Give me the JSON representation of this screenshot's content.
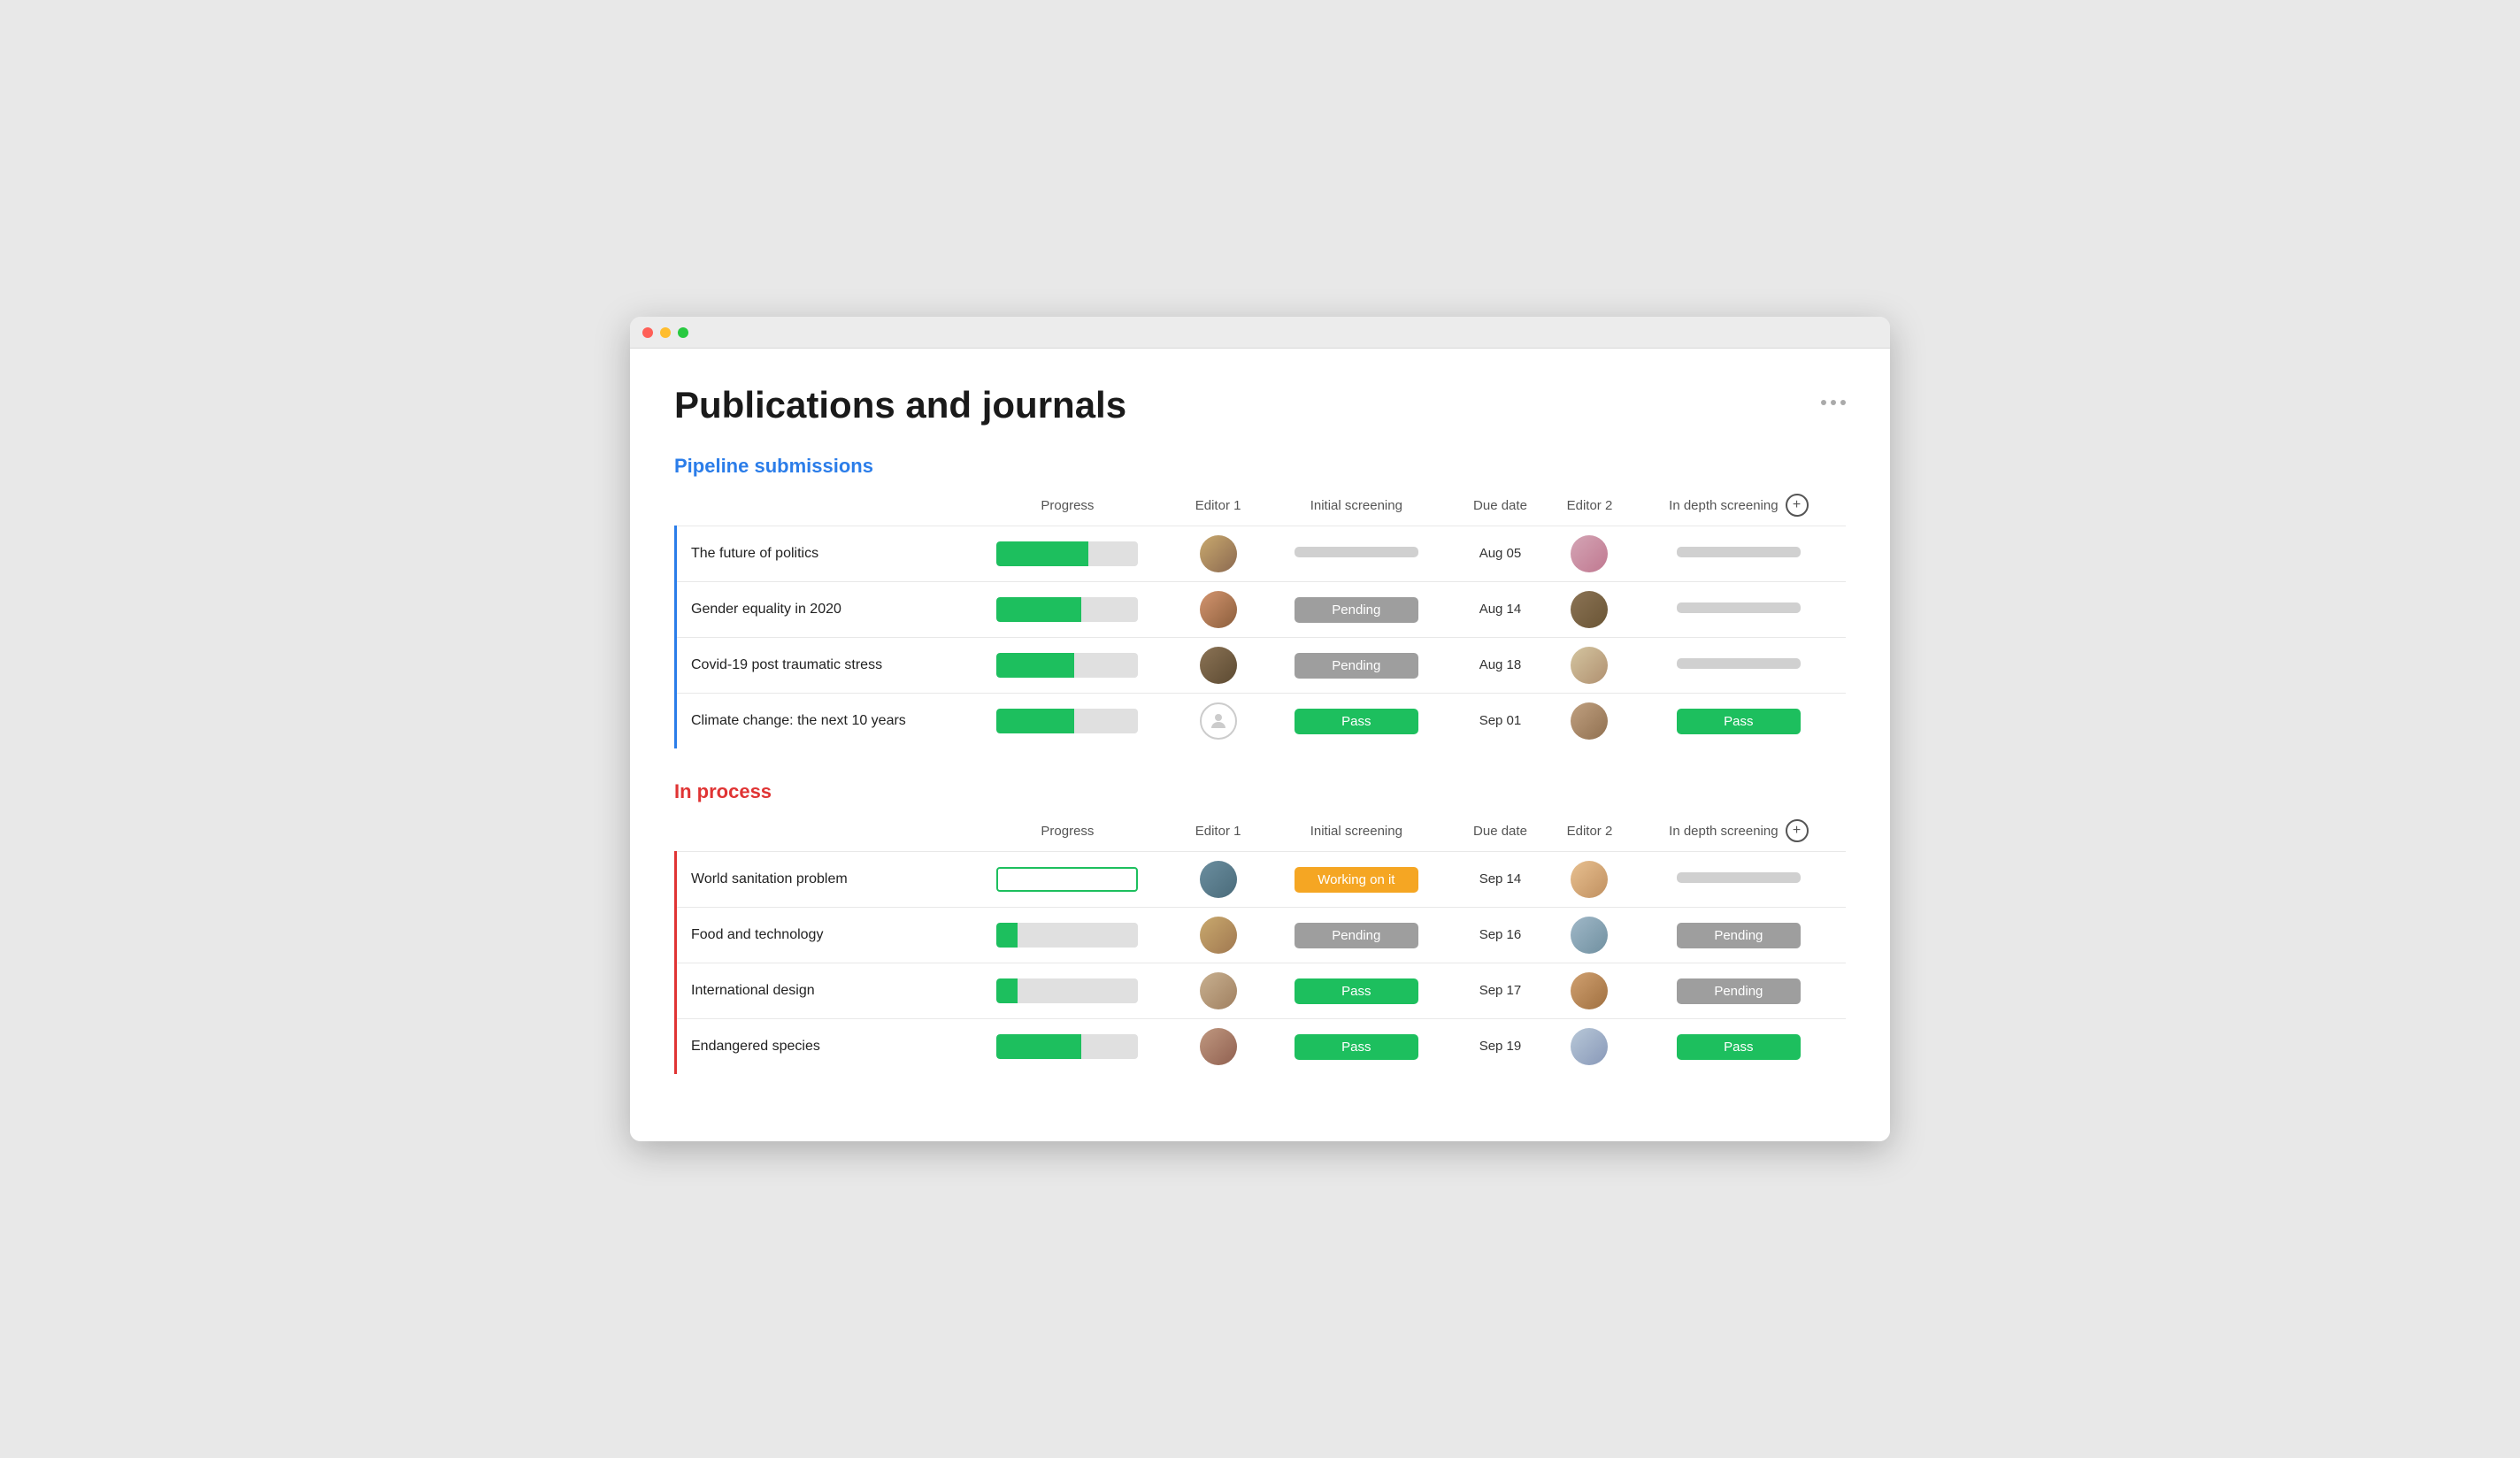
{
  "window": {
    "title": "Publications and journals"
  },
  "page": {
    "title": "Publications and journals",
    "more_label": "..."
  },
  "pipeline": {
    "section_title": "Pipeline submissions",
    "columns": {
      "title": "",
      "progress": "Progress",
      "editor1": "Editor 1",
      "initial_screening": "Initial screening",
      "due_date": "Due date",
      "editor2": "Editor 2",
      "in_depth": "In depth screening"
    },
    "rows": [
      {
        "title": "The future of politics",
        "progress": 65,
        "progress_type": "normal",
        "editor1_avatar": "av1",
        "initial_screening": "",
        "initial_screening_type": "empty",
        "due_date": "Aug 05",
        "editor2_avatar": "av6",
        "in_depth": "",
        "in_depth_type": "empty"
      },
      {
        "title": "Gender equality in 2020",
        "progress": 60,
        "progress_type": "normal",
        "editor1_avatar": "av2",
        "initial_screening": "Pending",
        "initial_screening_type": "pending",
        "due_date": "Aug 14",
        "editor2_avatar": "av7",
        "in_depth": "",
        "in_depth_type": "empty"
      },
      {
        "title": "Covid-19 post traumatic stress",
        "progress": 55,
        "progress_type": "normal",
        "editor1_avatar": "av3",
        "initial_screening": "Pending",
        "initial_screening_type": "pending",
        "due_date": "Aug 18",
        "editor2_avatar": "av8",
        "in_depth": "",
        "in_depth_type": "empty"
      },
      {
        "title": "Climate change: the next 10 years",
        "progress": 55,
        "progress_type": "normal",
        "editor1_avatar": "placeholder",
        "initial_screening": "Pass",
        "initial_screening_type": "pass",
        "due_date": "Sep 01",
        "editor2_avatar": "av9",
        "in_depth": "Pass",
        "in_depth_type": "pass"
      }
    ]
  },
  "inprocess": {
    "section_title": "In process",
    "columns": {
      "title": "",
      "progress": "Progress",
      "editor1": "Editor 1",
      "initial_screening": "Initial screening",
      "due_date": "Due date",
      "editor2": "Editor 2",
      "in_depth": "In depth screening"
    },
    "rows": [
      {
        "title": "World sanitation problem",
        "progress": 0,
        "progress_type": "outline",
        "editor1_avatar": "av4",
        "initial_screening": "Working on it",
        "initial_screening_type": "working",
        "due_date": "Sep 14",
        "editor2_avatar": "av10",
        "in_depth": "",
        "in_depth_type": "empty"
      },
      {
        "title": "Food and technology",
        "progress": 15,
        "progress_type": "normal",
        "editor1_avatar": "av5",
        "initial_screening": "Pending",
        "initial_screening_type": "pending",
        "due_date": "Sep 16",
        "editor2_avatar": "av11",
        "in_depth": "Pending",
        "in_depth_type": "pending"
      },
      {
        "title": "International design",
        "progress": 15,
        "progress_type": "normal",
        "editor1_avatar": "av12",
        "initial_screening": "Pass",
        "initial_screening_type": "pass",
        "due_date": "Sep 17",
        "editor2_avatar": "av13",
        "in_depth": "Pending",
        "in_depth_type": "pending"
      },
      {
        "title": "Endangered species",
        "progress": 60,
        "progress_type": "normal",
        "editor1_avatar": "av14",
        "initial_screening": "Pass",
        "initial_screening_type": "pass",
        "due_date": "Sep 19",
        "editor2_avatar": "av15",
        "in_depth": "Pass",
        "in_depth_type": "pass"
      }
    ]
  },
  "badge_labels": {
    "pending": "Pending",
    "pass": "Pass",
    "working": "Working on it",
    "empty": ""
  }
}
